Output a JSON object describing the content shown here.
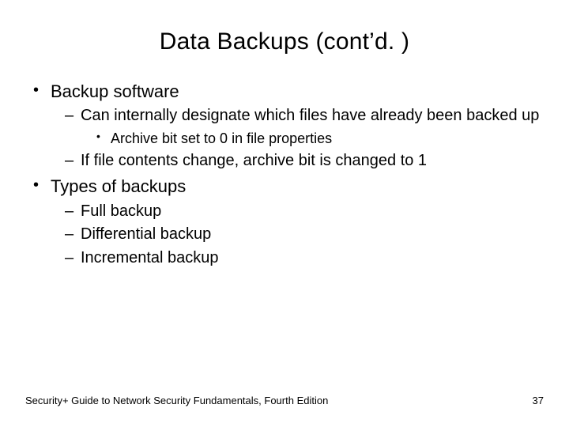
{
  "title": "Data Backups (cont’d. )",
  "bullets": {
    "b1": {
      "text": "Backup software",
      "s1": {
        "text": "Can internally designate which files have already been backed up",
        "ss1": "Archive bit set to 0 in file properties"
      },
      "s2": {
        "text": "If file contents change, archive bit is changed to 1"
      }
    },
    "b2": {
      "text": "Types of backups",
      "s1": {
        "text": "Full backup"
      },
      "s2": {
        "text": "Differential backup"
      },
      "s3": {
        "text": "Incremental backup"
      }
    }
  },
  "footer": {
    "source": "Security+ Guide to Network Security Fundamentals, Fourth Edition",
    "page": "37"
  }
}
